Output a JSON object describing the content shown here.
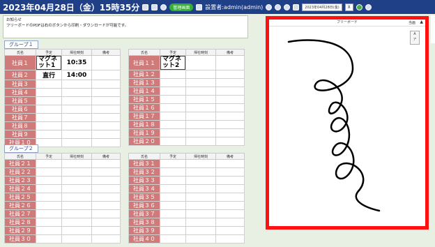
{
  "header": {
    "datetime": "2023年04月28日（金）15時35分",
    "badge": "管理画面",
    "user": "設置者:admin(admin)",
    "date_field": "2023年04月28日(金)",
    "close_label": "X"
  },
  "notice": {
    "title": "お知らせ",
    "text": "フリーボードのPDFは右のボタンから印刷・ダウンロードが可能です。"
  },
  "group1": {
    "label": "グループ１",
    "headers": [
      "氏名",
      "予定",
      "帰社時刻",
      "備考"
    ],
    "left_rows": [
      {
        "name": "社員１",
        "plan": "マグネット1",
        "time": "10:35",
        "note": ""
      },
      {
        "name": "社員２",
        "plan": "直行",
        "time": "14:00",
        "note": ""
      },
      {
        "name": "社員３",
        "plan": "",
        "time": "",
        "note": ""
      },
      {
        "name": "社員４",
        "plan": "",
        "time": "",
        "note": ""
      },
      {
        "name": "社員５",
        "plan": "",
        "time": "",
        "note": ""
      },
      {
        "name": "社員６",
        "plan": "",
        "time": "",
        "note": ""
      },
      {
        "name": "社員７",
        "plan": "",
        "time": "",
        "note": ""
      },
      {
        "name": "社員８",
        "plan": "",
        "time": "",
        "note": ""
      },
      {
        "name": "社員９",
        "plan": "",
        "time": "",
        "note": ""
      },
      {
        "name": "社員１０",
        "plan": "",
        "time": "",
        "note": ""
      }
    ],
    "right_rows": [
      {
        "name": "社員１１",
        "plan": "マグネット2",
        "time": "",
        "note": ""
      },
      {
        "name": "社員１２",
        "plan": "",
        "time": "",
        "note": ""
      },
      {
        "name": "社員１３",
        "plan": "",
        "time": "",
        "note": ""
      },
      {
        "name": "社員１４",
        "plan": "",
        "time": "",
        "note": ""
      },
      {
        "name": "社員１５",
        "plan": "",
        "time": "",
        "note": ""
      },
      {
        "name": "社員１６",
        "plan": "",
        "time": "",
        "note": ""
      },
      {
        "name": "社員１７",
        "plan": "",
        "time": "",
        "note": ""
      },
      {
        "name": "社員１８",
        "plan": "",
        "time": "",
        "note": ""
      },
      {
        "name": "社員１９",
        "plan": "",
        "time": "",
        "note": ""
      },
      {
        "name": "社員２０",
        "plan": "",
        "time": "",
        "note": ""
      }
    ]
  },
  "group2": {
    "label": "グループ２",
    "headers": [
      "氏名",
      "予定",
      "帰社時刻",
      "備考"
    ],
    "left_rows": [
      {
        "name": "社員２１"
      },
      {
        "name": "社員２２"
      },
      {
        "name": "社員２３"
      },
      {
        "name": "社員２４"
      },
      {
        "name": "社員２５"
      },
      {
        "name": "社員２６"
      },
      {
        "name": "社員２７"
      },
      {
        "name": "社員２８"
      },
      {
        "name": "社員２９"
      },
      {
        "name": "社員３０"
      }
    ],
    "right_rows": [
      {
        "name": "社員３１"
      },
      {
        "name": "社員３２"
      },
      {
        "name": "社員３３"
      },
      {
        "name": "社員３４"
      },
      {
        "name": "社員３５"
      },
      {
        "name": "社員３６"
      },
      {
        "name": "社員３７"
      },
      {
        "name": "社員３８"
      },
      {
        "name": "社員３９"
      },
      {
        "name": "社員４０"
      }
    ]
  },
  "freeboard": {
    "title": "フリーボード",
    "close_label": "当画",
    "zoom_labels": [
      "A",
      "ア"
    ],
    "border_color": "#ff1111",
    "name_cell_color": "#d07a7a",
    "header_color": "#1f3f86"
  }
}
